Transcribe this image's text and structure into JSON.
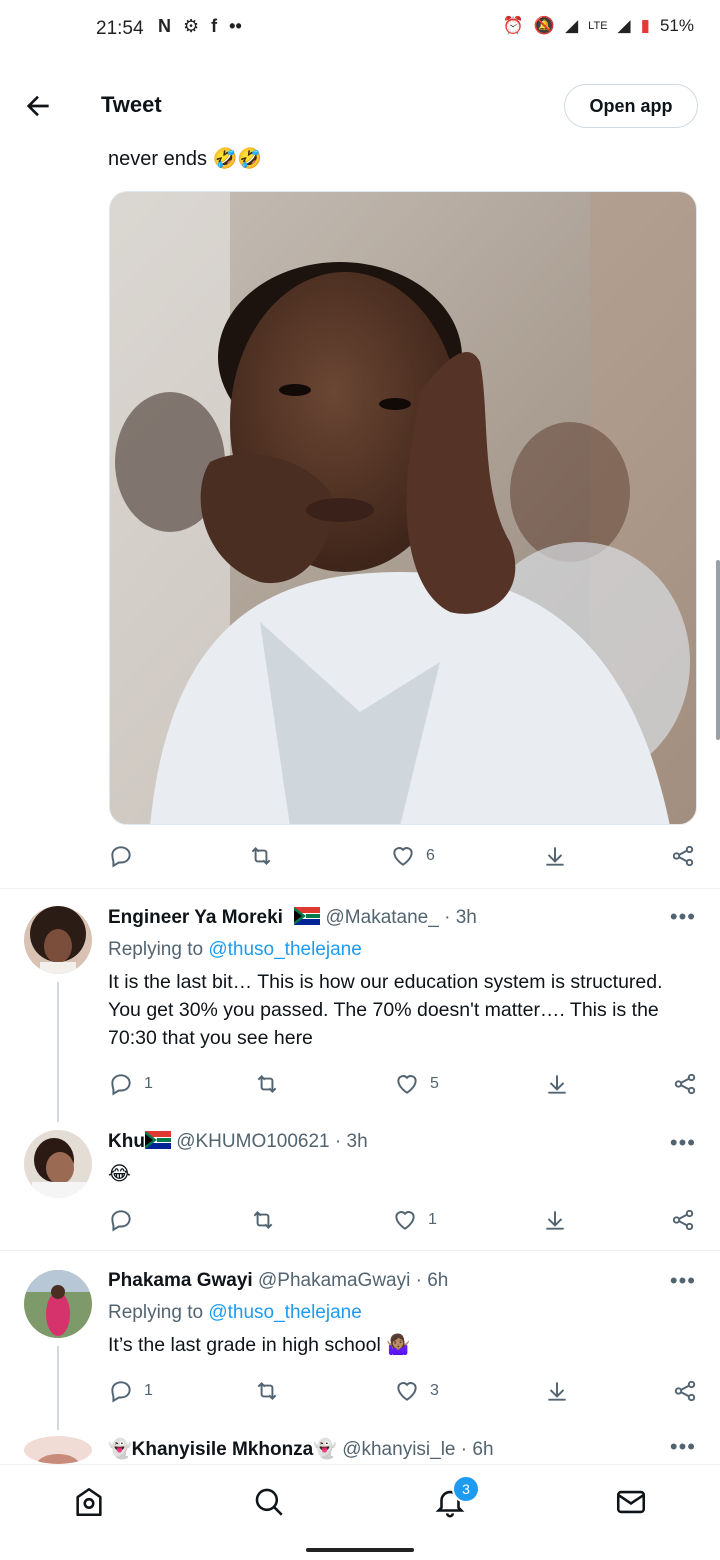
{
  "status": {
    "time": "21:54",
    "left_icons": [
      "N",
      "⚙",
      "f",
      "••"
    ],
    "battery": "51%",
    "network": "LTE"
  },
  "header": {
    "title": "Tweet",
    "open_app": "Open app"
  },
  "main_tweet": {
    "text": "never ends 🤣🤣",
    "likes": "6"
  },
  "replies": [
    {
      "name": "Engineer Ya Moreki",
      "handle": "@Makatane_",
      "time": "· 3h",
      "replying_prefix": "Replying to ",
      "replying_to": "@thuso_thelejane",
      "body": "It is the last bit… This is how our education system is structured. You get 30% you passed. The 70% doesn't matter…. This is the 70:30 that you see here",
      "reply_count": "1",
      "like_count": "5"
    },
    {
      "name": "Khu",
      "handle": "@KHUMO100621",
      "time": "· 3h",
      "body": "😂",
      "like_count": "1"
    },
    {
      "name": "Phakama Gwayi",
      "handle": "@PhakamaGwayi",
      "time": "· 6h",
      "replying_prefix": "Replying to ",
      "replying_to": "@thuso_thelejane",
      "body": "It’s the last grade in high school 🤷🏽‍♀️",
      "reply_count": "1",
      "like_count": "3"
    },
    {
      "name": "👻Khanyisile Mkhonza👻",
      "handle": "@khanyisi_le",
      "time": "· 6h"
    }
  ],
  "nav": {
    "notification_badge": "3"
  },
  "colors": {
    "link": "#1d9bf0",
    "muted": "#536471",
    "text": "#0f1419"
  }
}
